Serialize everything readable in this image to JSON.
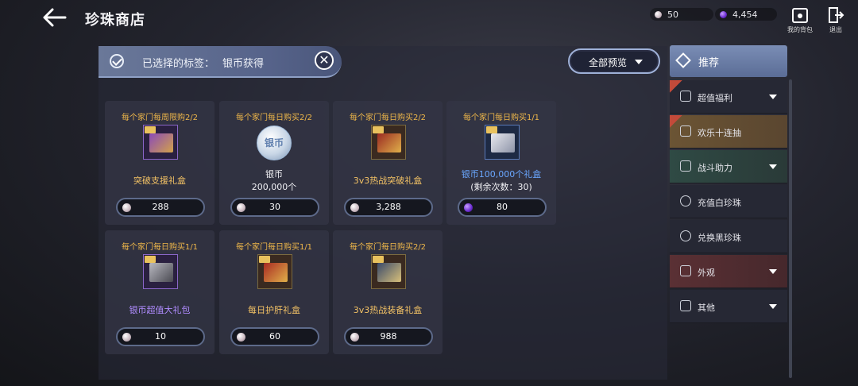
{
  "header": {
    "title": "珍珠商店",
    "currency": [
      {
        "icon": "white-pearl-icon",
        "value": "50"
      },
      {
        "icon": "black-pearl-icon",
        "value": "4,454"
      }
    ],
    "bag_label": "我的背包",
    "exit_label": "退出"
  },
  "filter": {
    "label": "已选择的标签：",
    "value": "银币获得",
    "preview_label": "全部预览"
  },
  "items": [
    {
      "limit": "每个家门每周限购2/2",
      "name": "突破支援礼盒",
      "name2": "",
      "price": "288",
      "coin": "white-pearl"
    },
    {
      "limit": "每个家门每日购买2/2",
      "name": "银币",
      "name2": "200,000个",
      "price": "30",
      "coin": "white-pearl",
      "coin_text": "银币"
    },
    {
      "limit": "每个家门每日购买2/2",
      "name": "3v3热战突破礼盒",
      "name2": "",
      "price": "3,288",
      "coin": "white-pearl"
    },
    {
      "limit": "每个家门每日购买1/1",
      "name": "银币100,000个礼盒",
      "name2": "(剩余次数：30)",
      "price": "80",
      "coin": "black-pearl"
    },
    {
      "limit": "每个家门每日购买1/1",
      "name": "银币超值大礼包",
      "name2": "",
      "price": "10",
      "coin": "white-pearl"
    },
    {
      "limit": "每个家门每日购买1/1",
      "name": "每日护肝礼盒",
      "name2": "",
      "price": "60",
      "coin": "white-pearl"
    },
    {
      "limit": "每个家门每日购买2/2",
      "name": "3v3热战装备礼盒",
      "name2": "",
      "price": "988",
      "coin": "white-pearl"
    }
  ],
  "sidebar": {
    "recommend": "推荐",
    "items": [
      {
        "label": "超值福利",
        "icon": "gift-icon"
      },
      {
        "label": "欢乐十连抽",
        "icon": "gacha-icon"
      },
      {
        "label": "战斗助力",
        "icon": "battle-icon"
      },
      {
        "label": "充值白珍珠",
        "icon": "white-pearl-icon"
      },
      {
        "label": "兑换黑珍珠",
        "icon": "black-pearl-icon"
      },
      {
        "label": "外观",
        "icon": "outfit-icon"
      },
      {
        "label": "其他",
        "icon": "misc-icon"
      }
    ]
  },
  "colors": {
    "limit_text": "#f0b84a",
    "gold_name": "#f3c265",
    "blue_name": "#6aa7ff",
    "violet_name": "#b08cff",
    "accent": "#8fa1c6"
  }
}
